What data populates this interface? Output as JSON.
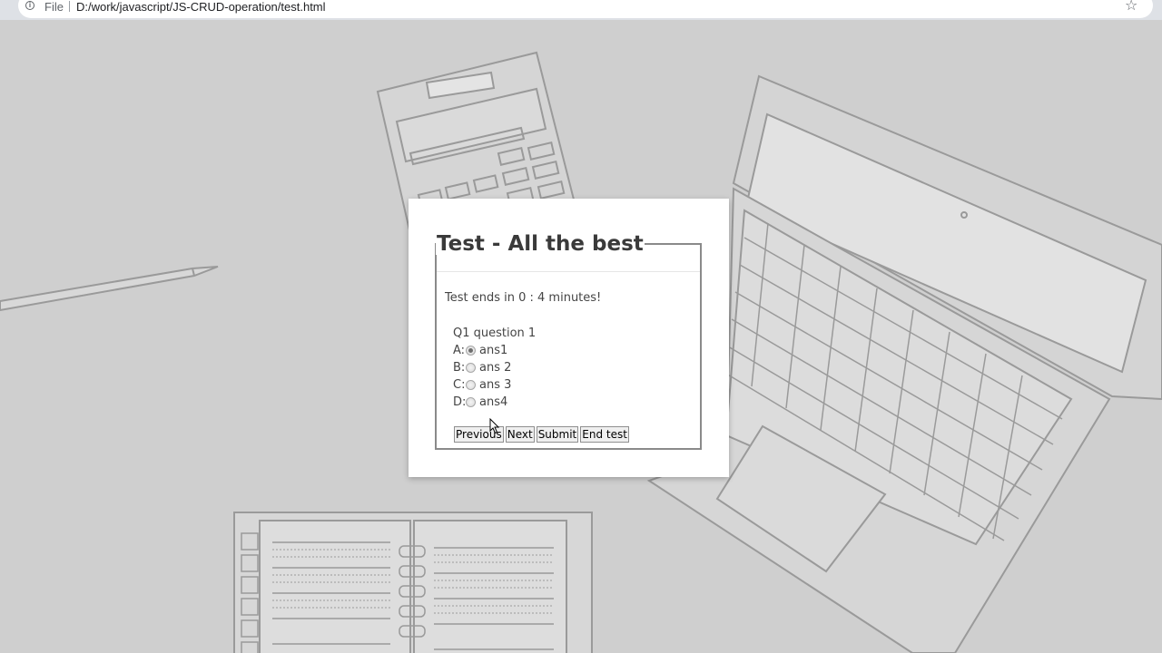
{
  "browser": {
    "scheme_label": "File",
    "url": "D:/work/javascript/JS-CRUD-operation/test.html"
  },
  "icons": {
    "info": "info-circle-icon",
    "bookmark": "star-icon",
    "pointer": "mouse-cursor-icon"
  },
  "test": {
    "title": "Test - All the best",
    "timer_text": "Test ends in 0 : 4 minutes!",
    "question": "Q1 question 1",
    "options": [
      {
        "letter": "A:",
        "label": "ans1",
        "selected": true
      },
      {
        "letter": "B:",
        "label": "ans 2",
        "selected": false
      },
      {
        "letter": "C:",
        "label": "ans 3",
        "selected": false
      },
      {
        "letter": "D:",
        "label": "ans4",
        "selected": false
      }
    ],
    "buttons": {
      "previous": "Previous",
      "next": "Next",
      "submit": "Submit",
      "end": "End test"
    }
  },
  "colors": {
    "page_background": "#cfcfcf",
    "illustration_stroke": "#9a9a9a",
    "card_background": "#ffffff"
  }
}
